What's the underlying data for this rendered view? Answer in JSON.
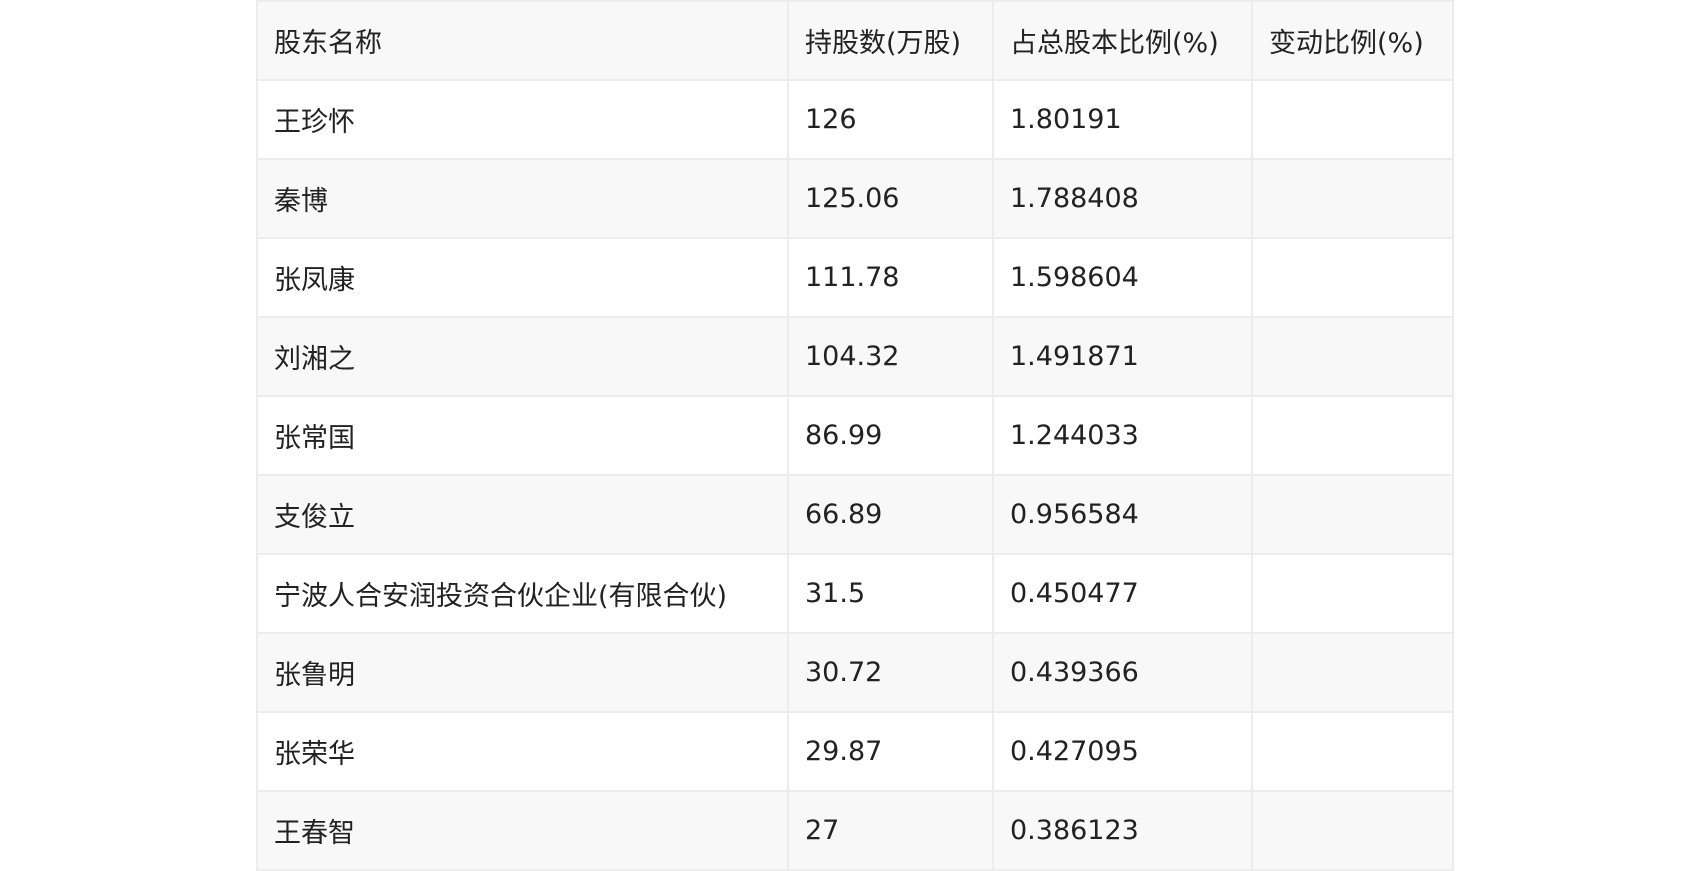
{
  "table": {
    "headers": [
      "股东名称",
      "持股数(万股)",
      "占总股本比例(%)",
      "变动比例(%)"
    ],
    "rows": [
      [
        "王珍怀",
        "126",
        "1.80191",
        ""
      ],
      [
        "秦博",
        "125.06",
        "1.788408",
        ""
      ],
      [
        "张凤康",
        "111.78",
        "1.598604",
        ""
      ],
      [
        "刘湘之",
        "104.32",
        "1.491871",
        ""
      ],
      [
        "张常国",
        "86.99",
        "1.244033",
        ""
      ],
      [
        "支俊立",
        "66.89",
        "0.956584",
        ""
      ],
      [
        "宁波人合安润投资合伙企业(有限合伙)",
        "31.5",
        "0.450477",
        ""
      ],
      [
        "张鲁明",
        "30.72",
        "0.439366",
        ""
      ],
      [
        "张荣华",
        "29.87",
        "0.427095",
        ""
      ],
      [
        "王春智",
        "27",
        "0.386123",
        ""
      ]
    ]
  }
}
